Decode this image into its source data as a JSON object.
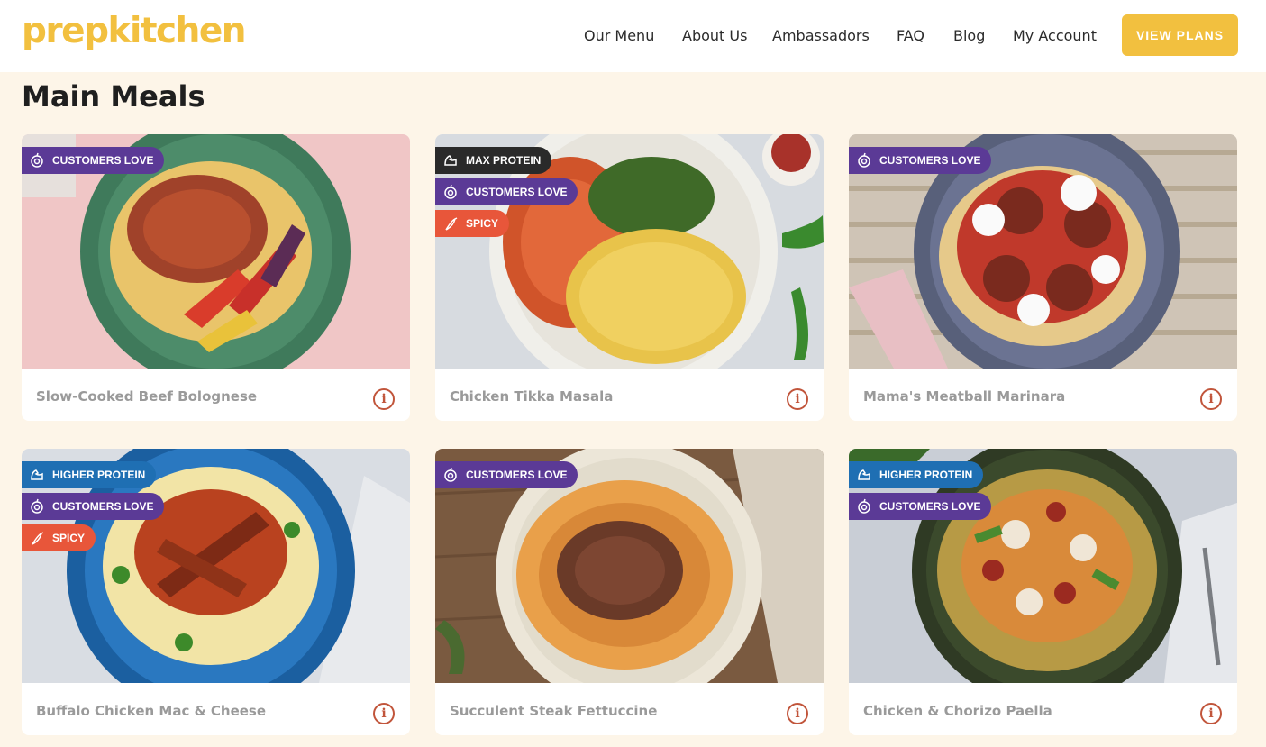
{
  "header": {
    "logo": "prepkitchen",
    "nav": [
      "Our Menu",
      "About Us",
      "Ambassadors",
      "FAQ",
      "Blog",
      "My Account"
    ],
    "cta": "VIEW PLANS"
  },
  "page_title": "Main Meals",
  "badge_labels": {
    "love": "CUSTOMERS LOVE",
    "maxp": "MAX PROTEIN",
    "spicy": "SPICY",
    "higher": "HIGHER PROTEIN"
  },
  "meals": [
    {
      "name": "Slow-Cooked Beef Bolognese",
      "badges": [
        "love"
      ]
    },
    {
      "name": "Chicken Tikka Masala",
      "badges": [
        "maxp",
        "love",
        "spicy"
      ]
    },
    {
      "name": "Mama's Meatball Marinara",
      "badges": [
        "love"
      ]
    },
    {
      "name": "Buffalo Chicken Mac & Cheese",
      "badges": [
        "higher",
        "love",
        "spicy"
      ]
    },
    {
      "name": "Succulent Steak Fettuccine",
      "badges": [
        "love"
      ]
    },
    {
      "name": "Chicken & Chorizo Paella",
      "badges": [
        "higher",
        "love"
      ]
    }
  ],
  "info_glyph": "i",
  "colors": {
    "brand_yellow": "#f2c03f",
    "badge_love": "#5b3a96",
    "badge_max_protein": "#2a2a2a",
    "badge_spicy": "#e8563a",
    "badge_higher_protein": "#1f6fb3",
    "info_accent": "#c1553b"
  }
}
